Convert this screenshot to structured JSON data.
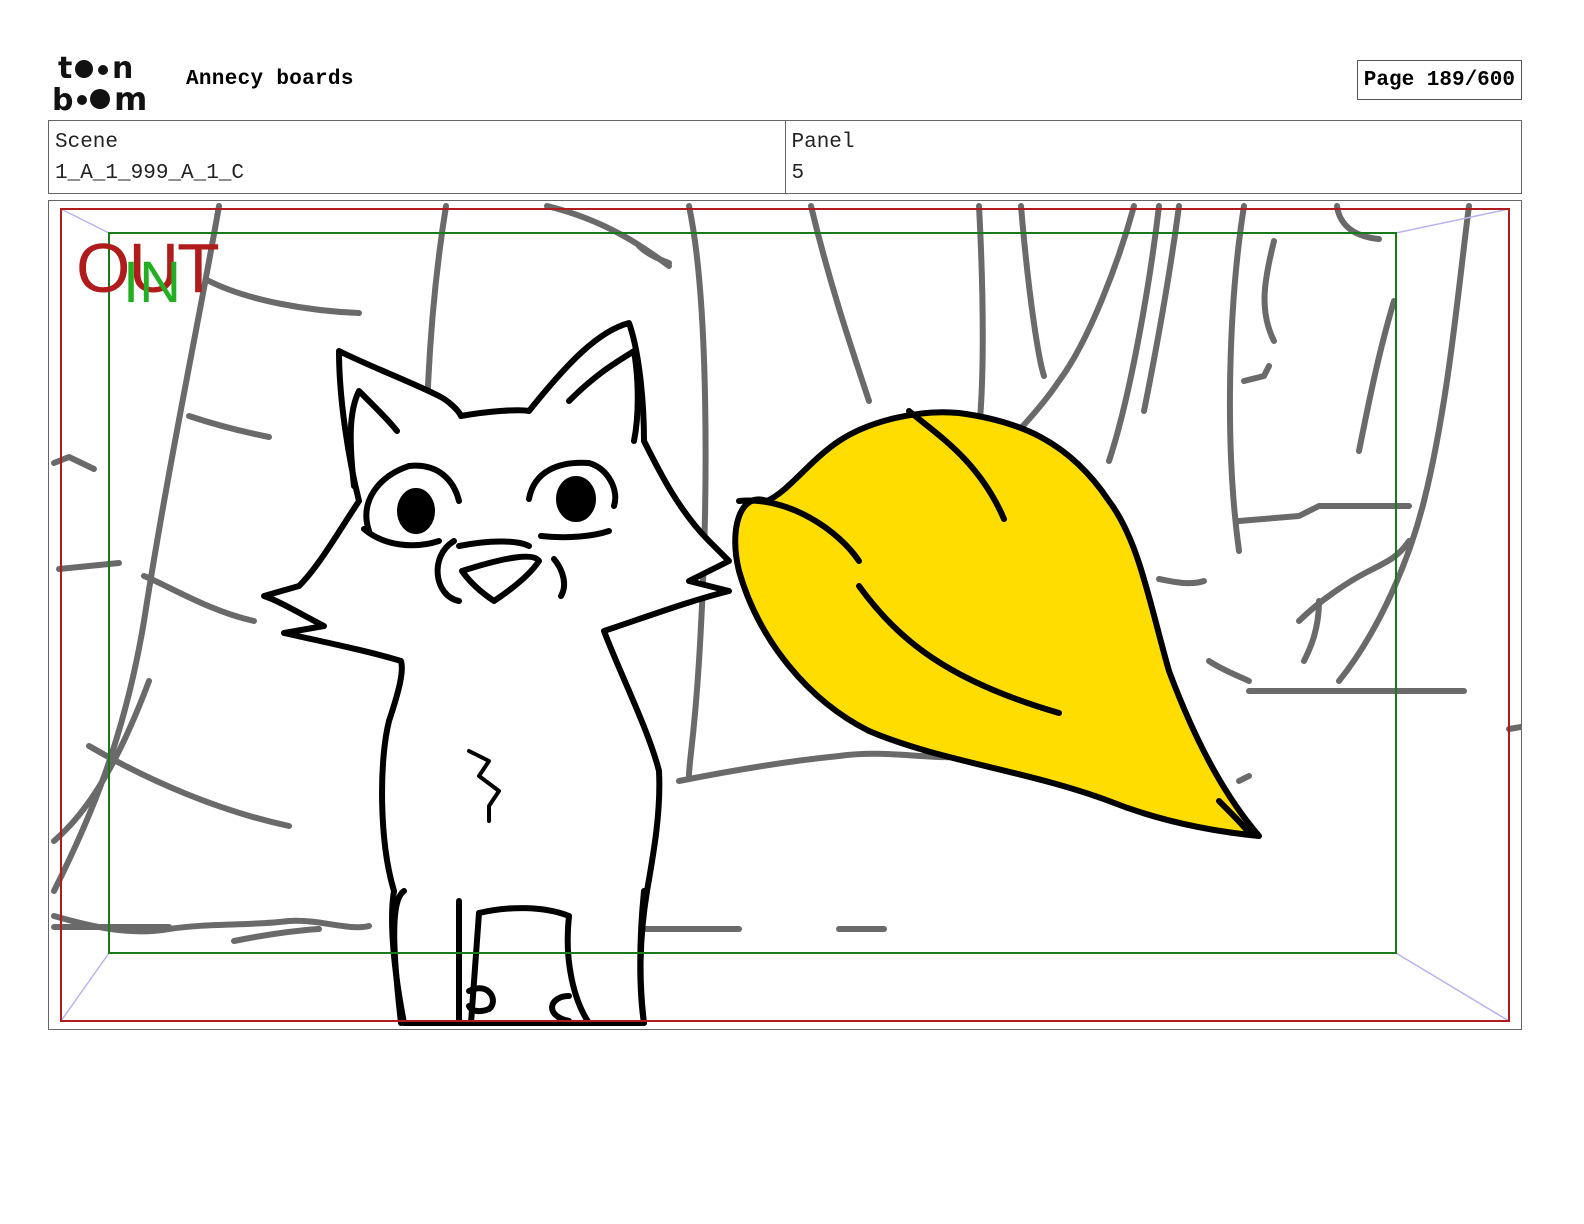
{
  "header": {
    "logo_text": "toon boom",
    "project_title": "Annecy boards",
    "page_indicator": "Page 189/600"
  },
  "info": {
    "scene_label": "Scene",
    "scene_value": "1_A_1_999_A_1_C",
    "panel_label": "Panel",
    "panel_value": "5"
  },
  "panel": {
    "out_label": "OUT",
    "in_label": "IN",
    "colors": {
      "out_frame": "#b01c1c",
      "in_frame": "#1a7a1a",
      "in_label": "#22b022",
      "tail_fill": "#ffdd00",
      "background_strokes": "#6a6a6a"
    },
    "subject": {
      "character_icon": "cartoon-fox-icon",
      "tail_icon": "yellow-tail-icon"
    }
  }
}
